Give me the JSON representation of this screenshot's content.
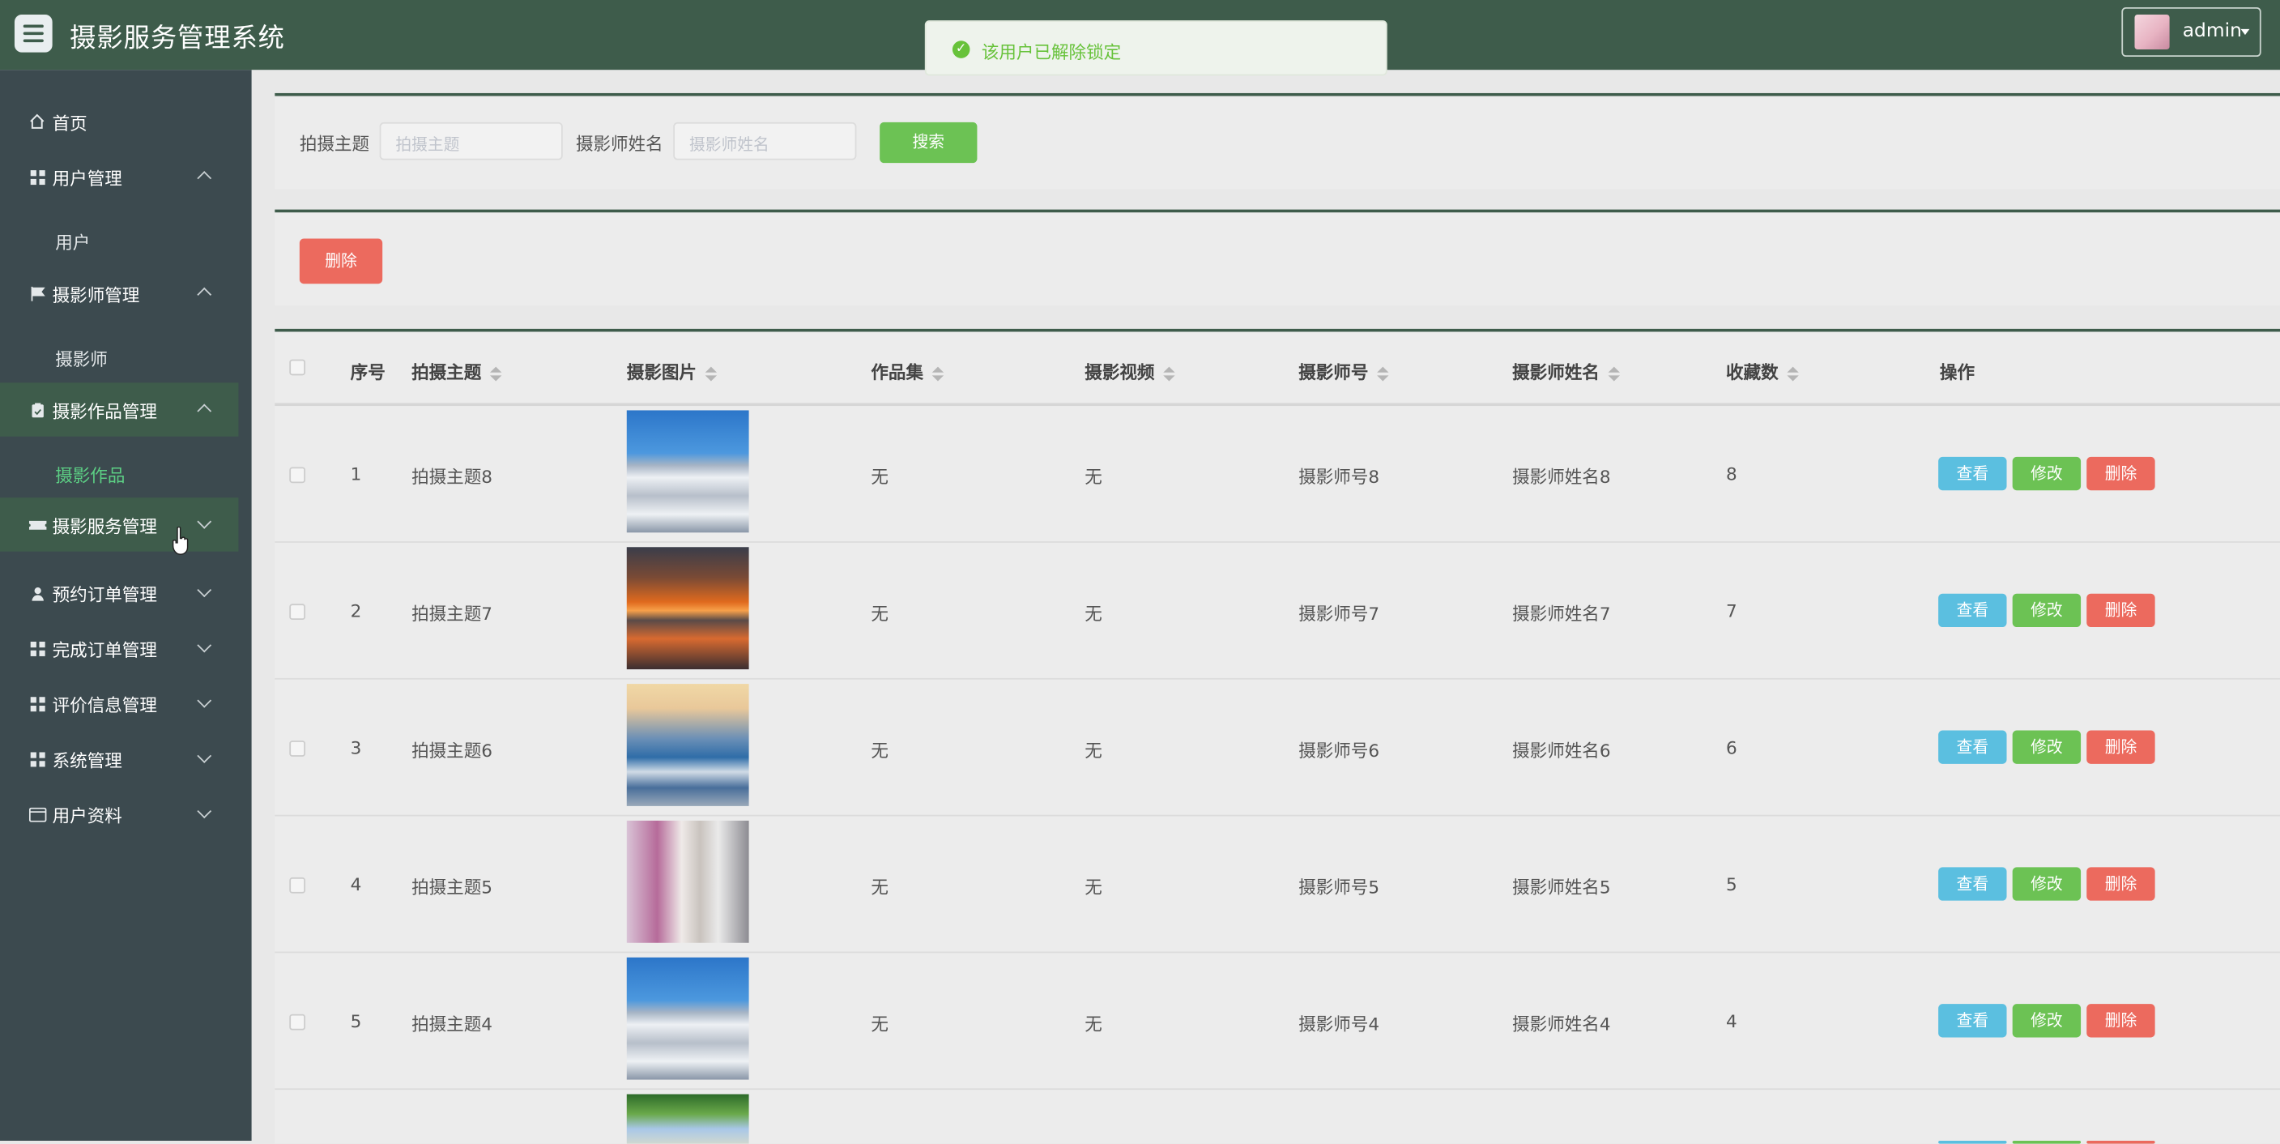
{
  "app": {
    "title": "摄影服务管理系统"
  },
  "toast": {
    "message": "该用户已解除锁定"
  },
  "user": {
    "name": "admin"
  },
  "sidebar": {
    "items": [
      {
        "label": "首页"
      },
      {
        "label": "用户管理"
      },
      {
        "label": "摄影师管理"
      },
      {
        "label": "摄影作品管理"
      },
      {
        "label": "摄影服务管理"
      },
      {
        "label": "预约订单管理"
      },
      {
        "label": "完成订单管理"
      },
      {
        "label": "评价信息管理"
      },
      {
        "label": "系统管理"
      },
      {
        "label": "用户资料"
      }
    ],
    "subs": {
      "user": "用户",
      "photographer": "摄影师",
      "works": "摄影作品"
    }
  },
  "search": {
    "theme_label": "拍摄主题",
    "theme_placeholder": "拍摄主题",
    "name_label": "摄影师姓名",
    "name_placeholder": "摄影师姓名",
    "button": "搜索"
  },
  "toolbar": {
    "delete": "删除"
  },
  "table": {
    "headers": [
      "序号",
      "拍摄主题",
      "摄影图片",
      "作品集",
      "摄影视频",
      "摄影师号",
      "摄影师姓名",
      "收藏数",
      "操作"
    ],
    "rows": [
      {
        "no": "1",
        "theme": "拍摄主题8",
        "set": "无",
        "video": "无",
        "pid": "摄影师号8",
        "pname": "摄影师姓名8",
        "fav": "8"
      },
      {
        "no": "2",
        "theme": "拍摄主题7",
        "set": "无",
        "video": "无",
        "pid": "摄影师号7",
        "pname": "摄影师姓名7",
        "fav": "7"
      },
      {
        "no": "3",
        "theme": "拍摄主题6",
        "set": "无",
        "video": "无",
        "pid": "摄影师号6",
        "pname": "摄影师姓名6",
        "fav": "6"
      },
      {
        "no": "4",
        "theme": "拍摄主题5",
        "set": "无",
        "video": "无",
        "pid": "摄影师号5",
        "pname": "摄影师姓名5",
        "fav": "5"
      },
      {
        "no": "5",
        "theme": "拍摄主题4",
        "set": "无",
        "video": "无",
        "pid": "摄影师号4",
        "pname": "摄影师姓名4",
        "fav": "4"
      }
    ],
    "actions": {
      "view": "查看",
      "edit": "修改",
      "delete": "删除"
    }
  },
  "colors": {
    "header": "#3e5c4b",
    "sidebar": "#3c4a4f",
    "accent_green": "#6cc254",
    "danger": "#ec6a5e",
    "info": "#5bbfe0"
  }
}
